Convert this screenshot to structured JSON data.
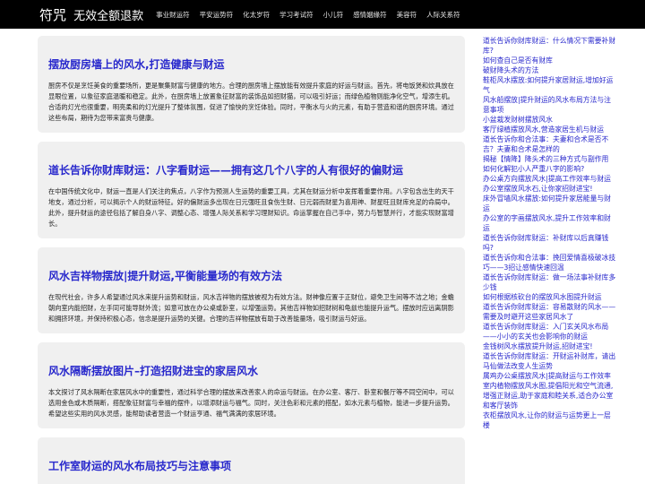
{
  "header": {
    "logo": "符咒",
    "tagline": "无效全额退款",
    "nav": [
      "事业财运符",
      "平安运势符",
      "化太岁符",
      "学习考试符",
      "小儿符",
      "感情姻缘符",
      "美容符",
      "人际关系符"
    ]
  },
  "articles": [
    {
      "title": "摆放厨房墙上的风水,打造健康与财运",
      "summary": "厨房不仅是烹饪美食的重要场所，更是聚集财富与健康的地方。合理的厨房墙上摆放能有效提升家庭的好运与财运。首先，将电饭煲和炊具放在显眼位置，以象征家庭温暖和稳定。此外，在厨房墙上放置象征财富的装饰品如招财猫，可以吸引好运；而绿色植物则能净化空气，增添生机。合适的灯光也很重要，明亮柔和的灯光提升了整体氛围，促进了愉快的烹饪体验。同时，平衡水与火的元素，有助于营造和谐的厨房环境。通过这些布局，期待为您带来富贵与健康。"
    },
    {
      "title": "道长告诉你财库财运：八字看财运——拥有这几个八字的人有很好的偏财运",
      "summary": "在中国传统文化中，财运一直是人们关注的焦点，八字作为预测人生运势的重要工具，尤其在财运分析中发挥着重要作用。八字包含出生的天干地支，通过分析，可以揭示个人的财运特征。好的偏财运多出现在日元强旺且食伤生财、日元弱而财星为喜用神、财星旺且财库充足的命局中。此外，提升财运的途径包括了解自身八字、调整心态、增强人际关系和学习理财知识。命运掌握在自己手中，努力与智慧并行，才能实现财富增长。"
    },
    {
      "title": "风水吉祥物摆放|提升财运,平衡能量场的有效方法",
      "summary": "在现代社会，许多人希望通过风水来提升运势和财运，风水吉祥物的摆放被视为有效方法。财神像应置于正财位，避免卫生间等不洁之地；金蟾朝向室内能招财，左手同可能导财外流；如意可放在办公桌或卧室，以增强运势。其他吉祥物如招财树和龟兹也能提升运气。摆放时应远离阴影和拥挤环境，并保持积极心态，信念是提升运势的关键。合理的吉祥物摆放有助于改善能量场，吸引财运与好运。"
    },
    {
      "title": "风水隔断摆放图片–打造招财进宝的家居风水",
      "summary": "本文探讨了风水隔断在家居风水中的重要性，通过科学合理的摆放来改善家人的命运与财运。在办公室、客厅、卧室和餐厅等不同空间中，可以选用金色或木质隔断，搭配象征财富与幸福的摆件，以增添财运与福气。同时，关注色彩和元素的搭配，如水元素与植物，能进一步提升运势。希望这些实用的风水灵感，能帮助读者营造一个财运亨通、福气满满的家居环境。"
    },
    {
      "title": "工作室财运的风水布局技巧与注意事项",
      "summary": ""
    }
  ],
  "sidebar": [
    "道长告诉你财库财运：什么情况下需要补财库?",
    "如何查自己是否有财库",
    "破财降头术的方法",
    "鞋柜风水摆放:如何提升家居财运,增加好运气",
    "风水船摆放|提升财运的风水布局方法与注意事项",
    "小盆栽发财树摆放风水",
    "客厅绿植摆放风水,营造家居生机与财运",
    "道长告诉你和合法事：夫妻和合术是否不吉？夫妻和合术是怎样的",
    "揭秘【情降】降头术的三种方式与副作用",
    "如何化解犯小人严重八字的影响?",
    "办公桌方向摆放风水|提高工作效率与财运",
    "办公室摆放风水石,让你家招财进宝!",
    "床外冒墙风水摆放:如何提升家居能量与财运",
    "办公室的字画摆放风水,提升工作效率和财运",
    "道长告诉你财库财运：补财库以后真赚钱吗?",
    "道长告诉你和合法事：挽回爱情喜极破冰技巧——3招让感情快速回温",
    "道长告诉你财库财运：做一场法事补财库多少钱",
    "如何根据核砍台的摆放风水图提升财运",
    "道长告诉你财库财运：容易散财的风水——需要及时避开这些家居风水了",
    "道长告诉你财库财运：入门玄关风水布局——小小的玄关也会影响你的财运",
    "金钱树风水摆放提升财运,招财进宝!",
    "道长告诉你财库财运：开财运补财库，请出马仙做法改变人生运势",
    "属鸡办公桌摆放风水|提高财运与工作效率",
    "室内植物摆放风水图,提倡阳光和空气流通,增强正财运,助于家庭和睦关系,适合办公室和客厅装饰",
    "衣柜摆放风水,让你的财运与运势更上一层楼"
  ]
}
